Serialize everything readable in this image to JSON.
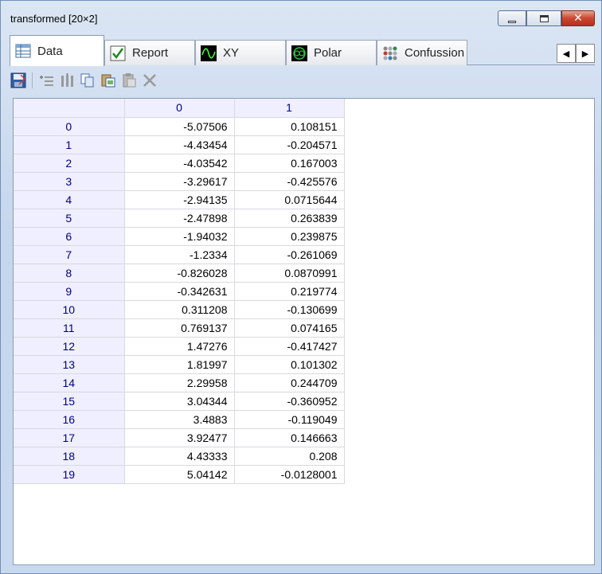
{
  "window": {
    "title": "transformed [20×2]",
    "close_glyph": "✕"
  },
  "tabs": [
    {
      "label": "Data",
      "icon": "table-icon",
      "active": true
    },
    {
      "label": "Report",
      "icon": "checkmark-icon",
      "active": false
    },
    {
      "label": "XY",
      "icon": "xy-plot-icon",
      "active": false
    },
    {
      "label": "Polar",
      "icon": "polar-plot-icon",
      "active": false
    },
    {
      "label": "Confussion",
      "icon": "confusion-matrix-icon",
      "active": false
    }
  ],
  "tab_scroll": {
    "left": "◀",
    "right": "▶"
  },
  "toolbar": {
    "icons": [
      "save-icon",
      "add-row-icon",
      "insert-column-icon",
      "copy-icon",
      "paste-special-icon",
      "paste-icon",
      "delete-icon"
    ]
  },
  "grid": {
    "columns": [
      "0",
      "1"
    ],
    "rows": [
      {
        "index": "0",
        "values": [
          "-5.07506",
          "0.108151"
        ]
      },
      {
        "index": "1",
        "values": [
          "-4.43454",
          "-0.204571"
        ]
      },
      {
        "index": "2",
        "values": [
          "-4.03542",
          "0.167003"
        ]
      },
      {
        "index": "3",
        "values": [
          "-3.29617",
          "-0.425576"
        ]
      },
      {
        "index": "4",
        "values": [
          "-2.94135",
          "0.0715644"
        ]
      },
      {
        "index": "5",
        "values": [
          "-2.47898",
          "0.263839"
        ]
      },
      {
        "index": "6",
        "values": [
          "-1.94032",
          "0.239875"
        ]
      },
      {
        "index": "7",
        "values": [
          "-1.2334",
          "-0.261069"
        ]
      },
      {
        "index": "8",
        "values": [
          "-0.826028",
          "0.0870991"
        ]
      },
      {
        "index": "9",
        "values": [
          "-0.342631",
          "0.219774"
        ]
      },
      {
        "index": "10",
        "values": [
          "0.311208",
          "-0.130699"
        ]
      },
      {
        "index": "11",
        "values": [
          "0.769137",
          "0.074165"
        ]
      },
      {
        "index": "12",
        "values": [
          "1.47276",
          "-0.417427"
        ]
      },
      {
        "index": "13",
        "values": [
          "1.81997",
          "0.101302"
        ]
      },
      {
        "index": "14",
        "values": [
          "2.29958",
          "0.244709"
        ]
      },
      {
        "index": "15",
        "values": [
          "3.04344",
          "-0.360952"
        ]
      },
      {
        "index": "16",
        "values": [
          "3.4883",
          "-0.119049"
        ]
      },
      {
        "index": "17",
        "values": [
          "3.92477",
          "0.146663"
        ]
      },
      {
        "index": "18",
        "values": [
          "4.43333",
          "0.208"
        ]
      },
      {
        "index": "19",
        "values": [
          "5.04142",
          "-0.0128001"
        ]
      }
    ]
  },
  "colors": {
    "header_bg": "#efefff",
    "header_text": "#000080",
    "frame": "#c6d6ec"
  }
}
